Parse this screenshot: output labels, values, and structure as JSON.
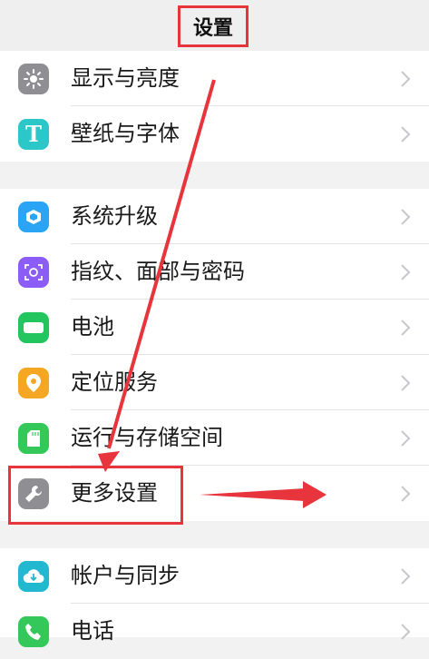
{
  "header": {
    "title": "设置"
  },
  "groups": [
    {
      "items": [
        {
          "label": "显示与亮度",
          "icon": "brightness-icon",
          "color": "#8e8e93"
        },
        {
          "label": "壁纸与字体",
          "icon": "font-t-icon",
          "color": "#2cc7c9"
        }
      ]
    },
    {
      "items": [
        {
          "label": "系统升级",
          "icon": "system-update-icon",
          "color": "#2aa4f4"
        },
        {
          "label": "指纹、面部与密码",
          "icon": "face-fingerprint-icon",
          "color": "#8b5cf6"
        },
        {
          "label": "电池",
          "icon": "battery-icon",
          "color": "#22c55e"
        },
        {
          "label": "定位服务",
          "icon": "location-pin-icon",
          "color": "#f5a623"
        },
        {
          "label": "运行与存储空间",
          "icon": "sd-card-icon",
          "color": "#34c759"
        },
        {
          "label": "更多设置",
          "icon": "wrench-icon",
          "color": "#8e8e93"
        }
      ]
    },
    {
      "items": [
        {
          "label": "帐户与同步",
          "icon": "cloud-sync-icon",
          "color": "#22b8cf"
        },
        {
          "label": "电话",
          "icon": "phone-icon",
          "color": "#34c759"
        }
      ]
    }
  ]
}
